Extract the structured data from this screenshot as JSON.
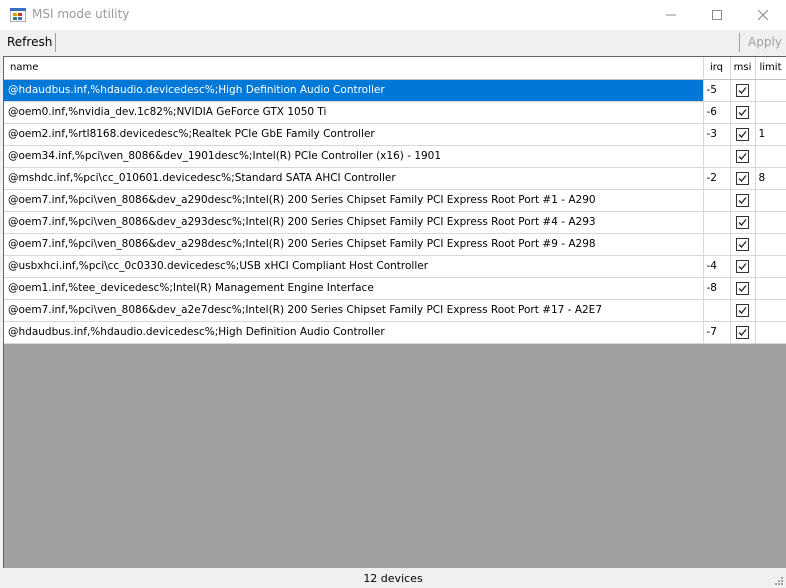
{
  "window": {
    "title": "MSI mode utility",
    "icon": "app-window-icon",
    "minimize_icon": "minimize-icon",
    "maximize_icon": "maximize-icon",
    "close_icon": "close-icon"
  },
  "toolbar": {
    "refresh_label": "Refresh",
    "apply_label": "Apply"
  },
  "grid": {
    "columns": {
      "name": "name",
      "irq": "irq",
      "msi": "msi",
      "limit": "limit"
    },
    "rows": [
      {
        "name": "@hdaudbus.inf,%hdaudio.devicedesc%;High Definition Audio Controller",
        "irq": "-5",
        "msi": true,
        "limit": "",
        "selected": true
      },
      {
        "name": "@oem0.inf,%nvidia_dev.1c82%;NVIDIA GeForce GTX 1050 Ti",
        "irq": "-6",
        "msi": true,
        "limit": ""
      },
      {
        "name": "@oem2.inf,%rtl8168.devicedesc%;Realtek PCIe GbE Family Controller",
        "irq": "-3",
        "msi": true,
        "limit": "1"
      },
      {
        "name": "@oem34.inf,%pci\\ven_8086&dev_1901desc%;Intel(R) PCIe Controller (x16) - 1901",
        "irq": "",
        "msi": true,
        "limit": ""
      },
      {
        "name": "@mshdc.inf,%pci\\cc_010601.devicedesc%;Standard SATA AHCI Controller",
        "irq": "-2",
        "msi": true,
        "limit": "8"
      },
      {
        "name": "@oem7.inf,%pci\\ven_8086&dev_a290desc%;Intel(R) 200 Series Chipset Family PCI Express Root Port #1 - A290",
        "irq": "",
        "msi": true,
        "limit": ""
      },
      {
        "name": "@oem7.inf,%pci\\ven_8086&dev_a293desc%;Intel(R) 200 Series Chipset Family PCI Express Root Port #4 - A293",
        "irq": "",
        "msi": true,
        "limit": ""
      },
      {
        "name": "@oem7.inf,%pci\\ven_8086&dev_a298desc%;Intel(R) 200 Series Chipset Family PCI Express Root Port #9 - A298",
        "irq": "",
        "msi": true,
        "limit": ""
      },
      {
        "name": "@usbxhci.inf,%pci\\cc_0c0330.devicedesc%;USB xHCI Compliant Host Controller",
        "irq": "-4",
        "msi": true,
        "limit": ""
      },
      {
        "name": "@oem1.inf,%tee_devicedesc%;Intel(R) Management Engine Interface",
        "irq": "-8",
        "msi": true,
        "limit": ""
      },
      {
        "name": "@oem7.inf,%pci\\ven_8086&dev_a2e7desc%;Intel(R) 200 Series Chipset Family PCI Express Root Port #17 - A2E7",
        "irq": "",
        "msi": true,
        "limit": ""
      },
      {
        "name": "@hdaudbus.inf,%hdaudio.devicedesc%;High Definition Audio Controller",
        "irq": "-7",
        "msi": true,
        "limit": ""
      }
    ]
  },
  "status": {
    "text": "12 devices",
    "grip_icon": "resize-grip-icon"
  },
  "colors": {
    "selection": "#0078d7",
    "empty_area": "#a0a0a0",
    "chrome": "#f0f0f0"
  }
}
